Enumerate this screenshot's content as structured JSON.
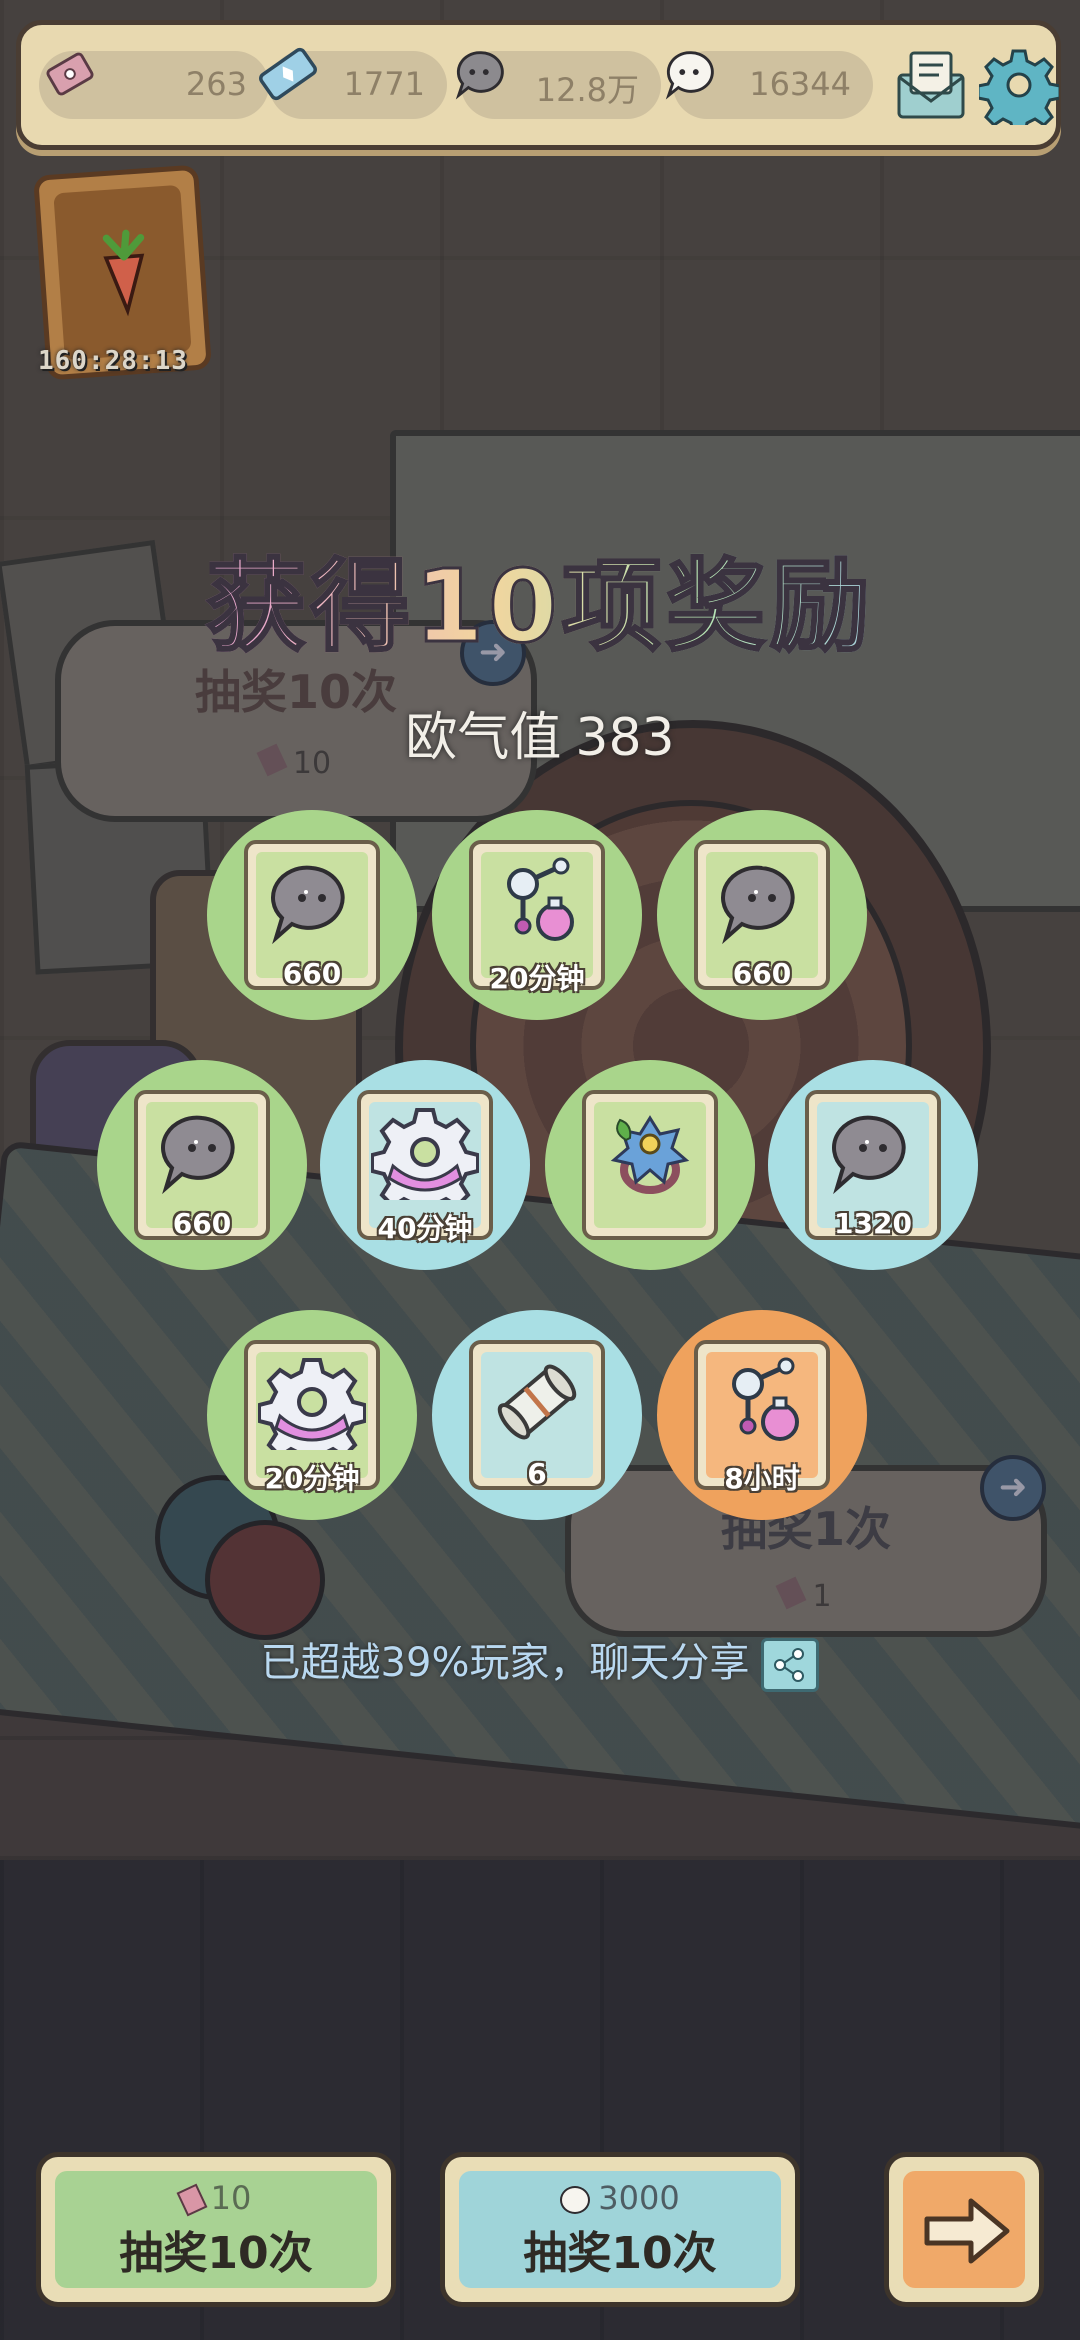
{
  "top_bar": {
    "ticket_count": "263",
    "crystal_count": "1771",
    "gray_bubble_count": "12.8万",
    "white_bubble_count": "16344",
    "icons": [
      "ticket-icon",
      "crystal-icon",
      "gray-bubble-icon",
      "white-bubble-icon",
      "mail-icon",
      "gear-icon"
    ]
  },
  "event": {
    "timer": "160:28:13"
  },
  "background_draw": {
    "ten_label": "抽奖10次",
    "ten_cost": "10",
    "one_label": "抽奖1次",
    "one_cost": "1"
  },
  "result": {
    "title": "获得10项奖励",
    "luck_label": "欧气值",
    "luck_value": "383",
    "rewards": [
      {
        "item": "gray-bubble",
        "qty": "660",
        "color": "green"
      },
      {
        "item": "potion-flask",
        "qty": "20分钟",
        "color": "green"
      },
      {
        "item": "gray-bubble",
        "qty": "660",
        "color": "green"
      },
      {
        "item": "gray-bubble",
        "qty": "660",
        "color": "green"
      },
      {
        "item": "gear",
        "qty": "40分钟",
        "color": "blue"
      },
      {
        "item": "flower-ring",
        "qty": "",
        "color": "green"
      },
      {
        "item": "gray-bubble",
        "qty": "1320",
        "color": "blue"
      },
      {
        "item": "gear",
        "qty": "20分钟",
        "color": "green"
      },
      {
        "item": "scroll",
        "qty": "6",
        "color": "blue"
      },
      {
        "item": "potion-flask",
        "qty": "8小时",
        "color": "orange"
      }
    ],
    "share_text": "已超越39%玩家，聊天分享"
  },
  "buttons": {
    "ticket_draw": {
      "cost": "10",
      "label": "抽奖10次"
    },
    "bubble_draw": {
      "cost": "3000",
      "label": "抽奖10次"
    },
    "next": {
      "label": ""
    }
  },
  "colors": {
    "green": "#a9d58b",
    "blue": "#a9dfe4",
    "orange": "#efa25d",
    "panel": "#e8d9b0"
  }
}
